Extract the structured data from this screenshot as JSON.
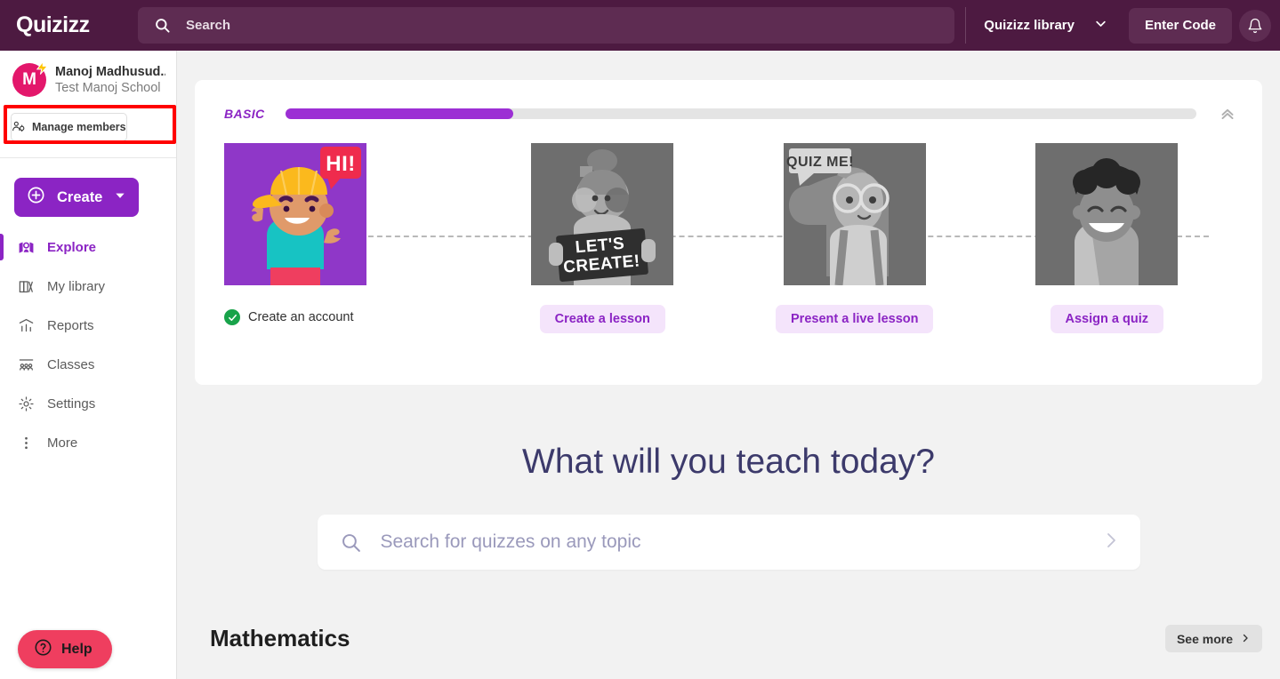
{
  "header": {
    "logo": "Quizizz",
    "search_placeholder": "Search",
    "search_value": "",
    "search_icon": "search-icon",
    "library_label": "Quizizz library",
    "library_caret": "chevron-down-icon",
    "enter_code_label": "Enter Code",
    "bell_icon": "notification-bell-icon",
    "bg_color": "#4d1a41"
  },
  "sidebar": {
    "profile": {
      "avatar_initial": "M",
      "avatar_color": "#e3176b",
      "badge_icon": "lightning-bolt-icon",
      "name": "Manoj Madhusud...",
      "school": "Test Manoj School"
    },
    "manage_members": {
      "label": "Manage members",
      "icon": "manage-members-icon"
    },
    "create": {
      "label": "Create",
      "plus_icon": "plus-circle-icon",
      "caret_icon": "caret-down-icon",
      "color": "#8b24c4"
    },
    "items": [
      {
        "label": "Explore",
        "icon": "explore-map-icon",
        "active": true
      },
      {
        "label": "My library",
        "icon": "library-books-icon",
        "active": false
      },
      {
        "label": "Reports",
        "icon": "reports-chart-icon",
        "active": false
      },
      {
        "label": "Classes",
        "icon": "classes-people-icon",
        "active": false
      },
      {
        "label": "Settings",
        "icon": "gear-icon",
        "active": false
      },
      {
        "label": "More",
        "icon": "more-vertical-icon",
        "active": false
      }
    ],
    "help": {
      "label": "Help",
      "icon": "question-circle-icon",
      "color": "#ef3e5f"
    }
  },
  "annotation": {
    "type": "red-highlight-box",
    "target": "manage-members-button",
    "color": "#ff0000"
  },
  "onboarding": {
    "plan_label": "BASIC",
    "progress_percent": 25,
    "progress_color": "#9c2fd4",
    "collapse_icon": "double-chevron-up-icon",
    "steps": [
      {
        "label": "Create an account",
        "state": "done",
        "tile": "hi-character",
        "bubble": "HI!",
        "tile_color": "#8f37c8"
      },
      {
        "label": "Create a lesson",
        "state": "pending",
        "tile": "lets-create-character",
        "bubble": "LET'S CREATE!",
        "tile_color": "#6e6e6e"
      },
      {
        "label": "Present a live lesson",
        "state": "pending",
        "tile": "quiz-me-character",
        "bubble": "QUIZ ME!",
        "tile_color": "#6e6e6e"
      },
      {
        "label": "Assign a quiz",
        "state": "pending",
        "tile": "smiling-character",
        "bubble": "",
        "tile_color": "#6e6e6e"
      }
    ]
  },
  "main": {
    "heading": "What will you teach today?",
    "search_placeholder": "Search for quizzes on any topic",
    "search_value": "",
    "search_icon": "search-icon",
    "submit_icon": "chevron-right-icon",
    "subject": {
      "title": "Mathematics",
      "see_more": "See more",
      "see_more_icon": "chevron-right-icon"
    }
  }
}
